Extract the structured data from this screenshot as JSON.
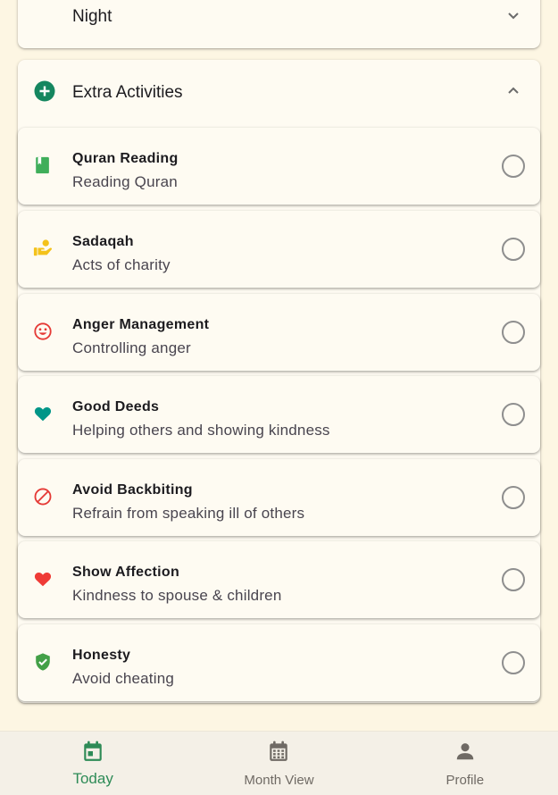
{
  "sections": {
    "night": {
      "title": "Night",
      "icon": "moon-icon",
      "expanded": false,
      "icon_color": "#7b4fc9"
    },
    "extra": {
      "title": "Extra Activities",
      "icon": "add-circle-icon",
      "expanded": true,
      "icon_color": "#15865f"
    }
  },
  "activities": [
    {
      "title": "Quran Reading",
      "subtitle": "Reading Quran",
      "icon": "book-icon",
      "color": "#3fae5a",
      "checked": false
    },
    {
      "title": "Sadaqah",
      "subtitle": "Acts of charity",
      "icon": "charity-hand-icon",
      "color": "#f4c21b",
      "checked": false
    },
    {
      "title": "Anger Management",
      "subtitle": "Controlling anger",
      "icon": "smiley-face-icon",
      "color": "#e53935",
      "checked": false
    },
    {
      "title": "Good Deeds",
      "subtitle": "Helping others and showing kindness",
      "icon": "heart-icon",
      "color": "#009688",
      "checked": false
    },
    {
      "title": "Avoid Backbiting",
      "subtitle": "Refrain from speaking ill of others",
      "icon": "block-icon",
      "color": "#e53935",
      "checked": false
    },
    {
      "title": "Show Affection",
      "subtitle": "Kindness to spouse & children",
      "icon": "heart-icon",
      "color": "#ef3b36",
      "checked": false
    },
    {
      "title": "Honesty",
      "subtitle": "Avoid cheating",
      "icon": "verified-shield-icon",
      "color": "#43a047",
      "checked": false
    }
  ],
  "nav": {
    "items": [
      {
        "label": "Today",
        "icon": "calendar-today-icon",
        "active": true
      },
      {
        "label": "Month View",
        "icon": "calendar-month-icon",
        "active": false
      },
      {
        "label": "Profile",
        "icon": "person-icon",
        "active": false
      }
    ],
    "active_color": "#2e8b57",
    "inactive_color": "#6f6a64"
  }
}
